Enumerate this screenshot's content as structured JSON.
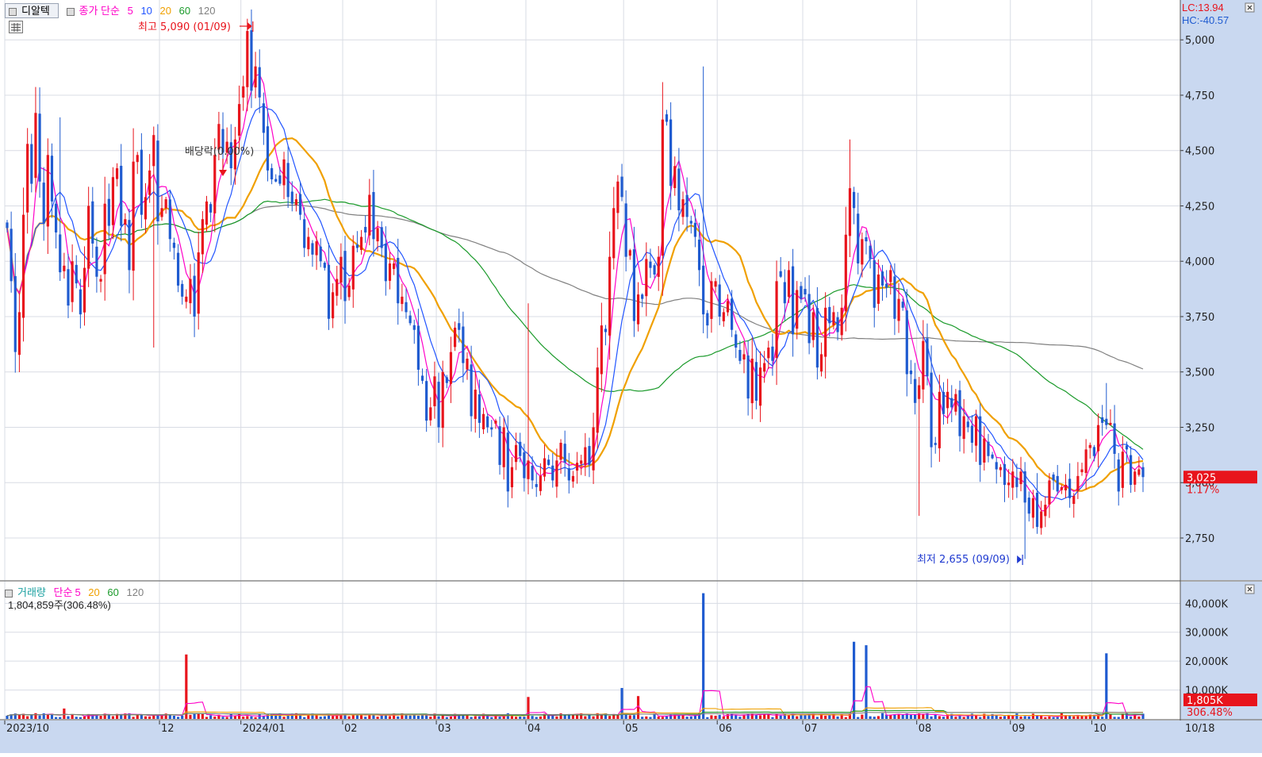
{
  "title": "디알텍",
  "price_legend": {
    "label": "종가 단순",
    "periods": [
      "5",
      "10",
      "20",
      "60",
      "120"
    ],
    "colors": [
      "#ff00c8",
      "#2255ff",
      "#f0a000",
      "#1a9a2a",
      "#808080"
    ]
  },
  "volume_legend": {
    "label": "거래량",
    "ma_label": "단순",
    "periods": [
      "5",
      "20",
      "60",
      "120"
    ],
    "colors": [
      "#ff00c8",
      "#f0a000",
      "#1a9a2a",
      "#808080"
    ]
  },
  "volume_info": "1,804,859주(306.48%)",
  "lc_label": "LC:13.94",
  "hc_label": "HC:-40.57",
  "annotations": {
    "high": "최고 5,090 (01/09)",
    "low": "최저 2,655 (09/09)",
    "dividend": "배당락(0.00%)"
  },
  "current": {
    "price_label": "3,025",
    "change_label": "1.17%",
    "volume_label": "1,805K",
    "volume_pct": "306.48%"
  },
  "colors": {
    "up": "#e8141c",
    "down": "#1f5bd0",
    "grid": "#d8dce4",
    "axis_bg": "#c9d8f0",
    "badge": "#e8141c"
  },
  "x_axis": {
    "labels": [
      {
        "text": "2023/10",
        "index": 0
      },
      {
        "text": "12",
        "index": 38
      },
      {
        "text": "2024/01",
        "index": 58
      },
      {
        "text": "02",
        "index": 83
      },
      {
        "text": "03",
        "index": 106
      },
      {
        "text": "04",
        "index": 128
      },
      {
        "text": "05",
        "index": 152
      },
      {
        "text": "06",
        "index": 175
      },
      {
        "text": "07",
        "index": 196
      },
      {
        "text": "08",
        "index": 224
      },
      {
        "text": "09",
        "index": 247
      },
      {
        "text": "10",
        "index": 267
      }
    ],
    "end_label": "10/18"
  },
  "chart_data": [
    {
      "type": "candlestick",
      "title": "디알텍",
      "x": "trading days, 2023/10 to 10/18 (276 sessions)",
      "y_ticks": [
        2750,
        3000,
        3250,
        3500,
        3750,
        4000,
        4250,
        4500,
        4750,
        5000
      ],
      "ylim": [
        2560,
        5180
      ],
      "highest": {
        "value": 5090,
        "date": "01/09"
      },
      "lowest": {
        "value": 2655,
        "date": "09/09"
      },
      "last_close": 3025,
      "change_pct": 1.17,
      "closes": [
        4150,
        3910,
        3590,
        3770,
        4210,
        4530,
        4350,
        4670,
        4360,
        4170,
        4480,
        4270,
        4130,
        3950,
        3980,
        3800,
        4000,
        3900,
        3760,
        3970,
        4250,
        4080,
        3930,
        3920,
        4260,
        4160,
        4380,
        4420,
        4160,
        4190,
        3960,
        4450,
        4480,
        4210,
        4290,
        4410,
        4570,
        4180,
        4240,
        4280,
        4100,
        4060,
        3890,
        3840,
        3840,
        3920,
        3750,
        4040,
        4190,
        4270,
        4220,
        4480,
        4620,
        4490,
        4540,
        4420,
        4550,
        4710,
        4790,
        5040,
        4770,
        4880,
        4740,
        4580,
        4410,
        4370,
        4360,
        4350,
        4460,
        4290,
        4260,
        4280,
        4210,
        4060,
        4110,
        4030,
        4090,
        4000,
        3970,
        3740,
        3860,
        3920,
        4020,
        3820,
        3890,
        4070,
        4060,
        4110,
        4130,
        4300,
        4100,
        4150,
        4060,
        3910,
        3990,
        3990,
        3810,
        3840,
        3770,
        3720,
        3690,
        3510,
        3460,
        3280,
        3340,
        3480,
        3250,
        3500,
        3450,
        3590,
        3700,
        3690,
        3540,
        3560,
        3300,
        3420,
        3270,
        3310,
        3250,
        3240,
        3280,
        3080,
        3250,
        2960,
        3070,
        3170,
        3120,
        3020,
        3100,
        3010,
        2980,
        3030,
        3110,
        3080,
        3010,
        3100,
        3180,
        3090,
        3010,
        3030,
        3090,
        3100,
        3160,
        3080,
        3250,
        3520,
        3710,
        3680,
        4020,
        4240,
        4360,
        4290,
        4020,
        4050,
        3730,
        3850,
        3830,
        4010,
        3970,
        3940,
        4020,
        4640,
        4630,
        4340,
        4430,
        4230,
        4280,
        4200,
        4170,
        4110,
        3960,
        3760,
        3710,
        3910,
        3910,
        3750,
        3770,
        3820,
        3690,
        3610,
        3550,
        3580,
        3380,
        3560,
        3370,
        3520,
        3540,
        3610,
        3550,
        3910,
        3930,
        3810,
        3960,
        3670,
        3870,
        3830,
        3850,
        3630,
        3770,
        3520,
        3580,
        3790,
        3720,
        3770,
        3680,
        3790,
        4120,
        4330,
        4240,
        3990,
        4100,
        4090,
        4010,
        3790,
        3940,
        3890,
        3880,
        3960,
        3740,
        3830,
        3790,
        3490,
        3490,
        3360,
        3440,
        3640,
        3480,
        3160,
        3170,
        3410,
        3310,
        3410,
        3340,
        3400,
        3210,
        3300,
        3250,
        3180,
        3300,
        3080,
        3200,
        3120,
        3110,
        3060,
        3070,
        2990,
        3000,
        3050,
        2980,
        3050,
        2910,
        2860,
        2930,
        2800,
        2870,
        2900,
        3010,
        3010,
        2960,
        2980,
        2990,
        2930,
        2940,
        3030,
        3060,
        3150,
        3170,
        3120,
        3260,
        3270,
        3260,
        3270,
        3130,
        2960,
        3140,
        3150,
        2990,
        3050,
        3060,
        3025
      ],
      "ma_periods": [
        5,
        10,
        20,
        60,
        120
      ]
    },
    {
      "type": "bar",
      "title": "거래량",
      "y_ticks_label": [
        "10,000K",
        "20,000K",
        "30,000K",
        "40,000K"
      ],
      "y_ticks": [
        10000,
        20000,
        30000,
        40000
      ],
      "ylim": [
        0,
        47500
      ],
      "units": "K shares",
      "spikes": [
        {
          "index": 14,
          "value": 3600
        },
        {
          "index": 44,
          "value": 22300
        },
        {
          "index": 128,
          "value": 7600
        },
        {
          "index": 151,
          "value": 10700
        },
        {
          "index": 155,
          "value": 7900
        },
        {
          "index": 171,
          "value": 43500
        },
        {
          "index": 208,
          "value": 26700
        },
        {
          "index": 211,
          "value": 25500
        },
        {
          "index": 270,
          "value": 22700
        }
      ],
      "last_value_k": 1805
    }
  ]
}
